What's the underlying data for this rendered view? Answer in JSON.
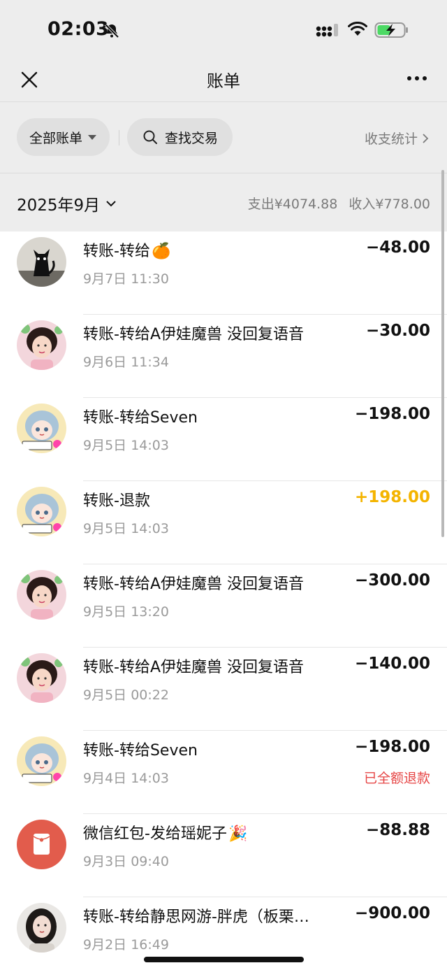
{
  "status": {
    "time": "02:03"
  },
  "nav": {
    "title": "账单"
  },
  "filters": {
    "all_bills": "全部账单",
    "search": "查找交易",
    "stats": "收支统计"
  },
  "month": {
    "label": "2025年9月",
    "expense": "支出¥4074.88",
    "income": "收入¥778.00"
  },
  "transactions": [
    {
      "title": "转账-转给",
      "emoji": "🍊",
      "date": "9月7日 11:30",
      "amount": "−48.00",
      "type": "expense",
      "note": "",
      "avatar": "cat"
    },
    {
      "title": "转账-转给A伊娃魔兽 没回复语音",
      "emoji": "",
      "date": "9月6日 11:34",
      "amount": "−30.00",
      "type": "expense",
      "note": "",
      "avatar": "girl"
    },
    {
      "title": "转账-转给Seven",
      "emoji": "",
      "date": "9月5日 14:03",
      "amount": "−198.00",
      "type": "expense",
      "note": "",
      "avatar": "anime"
    },
    {
      "title": "转账-退款",
      "emoji": "",
      "date": "9月5日 14:03",
      "amount": "+198.00",
      "type": "income",
      "note": "",
      "avatar": "anime"
    },
    {
      "title": "转账-转给A伊娃魔兽 没回复语音",
      "emoji": "",
      "date": "9月5日 13:20",
      "amount": "−300.00",
      "type": "expense",
      "note": "",
      "avatar": "girl"
    },
    {
      "title": "转账-转给A伊娃魔兽 没回复语音",
      "emoji": "",
      "date": "9月5日 00:22",
      "amount": "−140.00",
      "type": "expense",
      "note": "",
      "avatar": "girl"
    },
    {
      "title": "转账-转给Seven",
      "emoji": "",
      "date": "9月4日 14:03",
      "amount": "−198.00",
      "type": "expense",
      "note": "已全额退款",
      "avatar": "anime"
    },
    {
      "title": "微信红包-发给瑶妮子",
      "emoji": "🎉",
      "date": "9月3日 09:40",
      "amount": "−88.88",
      "type": "expense",
      "note": "",
      "avatar": "redpacket"
    },
    {
      "title": "转账-转给静思网游-胖虎（板栗…",
      "emoji": "",
      "date": "9月2日 16:49",
      "amount": "−900.00",
      "type": "expense",
      "note": "",
      "avatar": "woman"
    }
  ],
  "colors": {
    "income": "#f4b400",
    "refund": "#e64545",
    "redpacket": "#e25c4c"
  }
}
